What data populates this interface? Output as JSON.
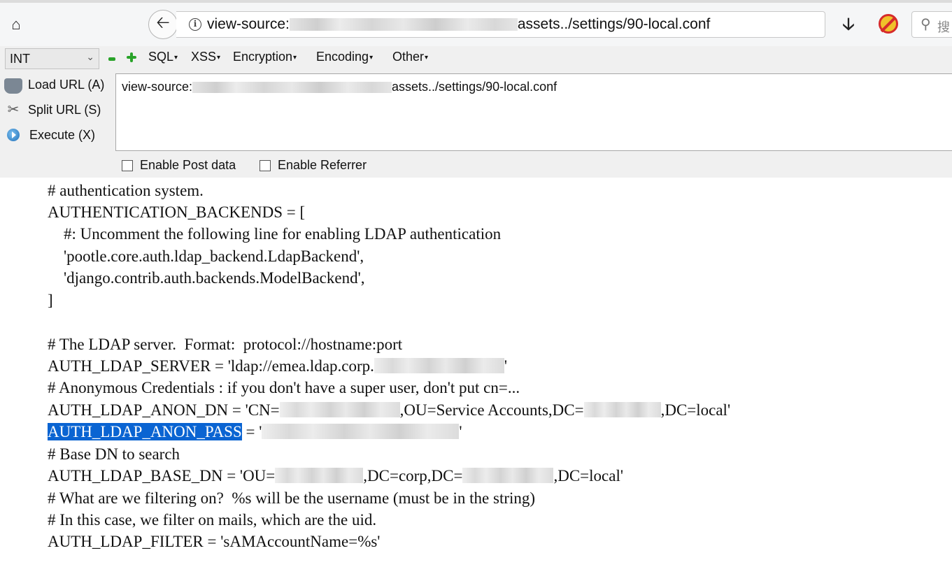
{
  "navbar": {
    "url_prefix": "view-source:",
    "url_suffix": "assets../settings/90-local.conf",
    "search_placeholder": "搜"
  },
  "hackbar": {
    "select_value": "INT",
    "menus": [
      "SQL",
      "XSS",
      "Encryption",
      "Encoding",
      "Other"
    ],
    "load_url_label": "Load URL (A)",
    "split_url_label": "Split URL (S)",
    "execute_label": "Execute (X)",
    "url_prefix": "view-source:",
    "url_suffix": "assets../settings/90-local.conf",
    "enable_post_label": "Enable Post data",
    "enable_referrer_label": "Enable Referrer"
  },
  "source": {
    "line_1": "# authentication system.",
    "line_2": "AUTHENTICATION_BACKENDS = [",
    "line_3": "    #: Uncomment the following line for enabling LDAP authentication",
    "line_4": "    'pootle.core.auth.ldap_backend.LdapBackend',",
    "line_5": "    'django.contrib.auth.backends.ModelBackend',",
    "line_6": "]",
    "line_8": "# The LDAP server.  Format:  protocol://hostname:port",
    "line_9a": "AUTH_LDAP_SERVER = 'ldap://emea.ldap.corp.",
    "line_9b": "'",
    "line_10": "# Anonymous Credentials : if you don't have a super user, don't put cn=...",
    "line_11a": "AUTH_LDAP_ANON_DN = 'CN=",
    "line_11b": ",OU=Service Accounts,DC=",
    "line_11c": ",DC=local'",
    "line_12_key": "AUTH_LDAP_ANON_PASS",
    "line_12a": " = '",
    "line_12b": "'",
    "line_13": "# Base DN to search",
    "line_14a": "AUTH_LDAP_BASE_DN = 'OU=",
    "line_14b": ",DC=corp,DC=",
    "line_14c": ",DC=local'",
    "line_15": "# What are we filtering on?  %s will be the username (must be in the string)",
    "line_16": "# In this case, we filter on mails, which are the uid.",
    "line_17": "AUTH_LDAP_FILTER = 'sAMAccountName=%s'"
  }
}
